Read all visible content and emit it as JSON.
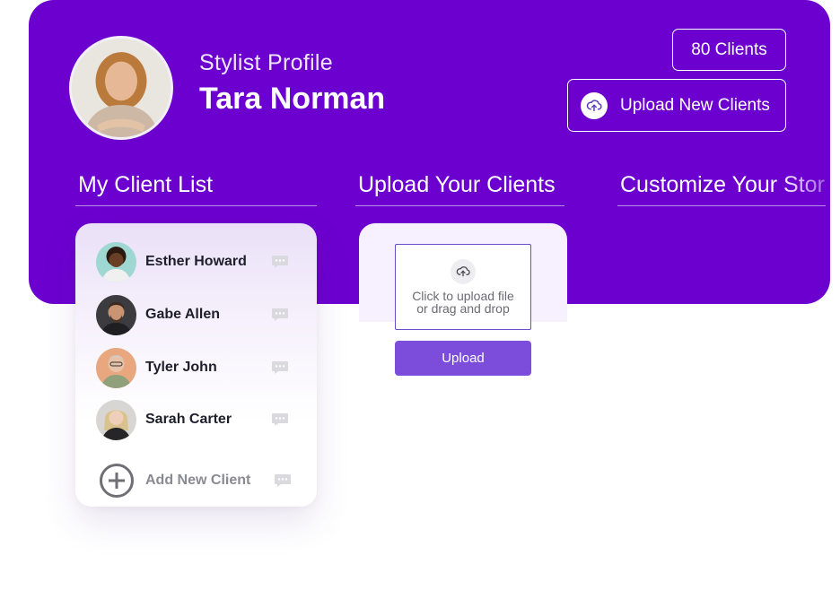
{
  "profile": {
    "subtitle": "Stylist Profile",
    "name": "Tara Norman"
  },
  "header": {
    "clients_count": "80 Clients",
    "upload_label": "Upload New Clients"
  },
  "tabs": [
    {
      "label": "My Client List"
    },
    {
      "label": "Upload Your Clients"
    },
    {
      "label_strong": "Customize ",
      "label_fade": "Your Store"
    }
  ],
  "client_list": {
    "items": [
      {
        "name": "Esther Howard"
      },
      {
        "name": "Gabe Allen"
      },
      {
        "name": "Tyler John"
      },
      {
        "name": "Sarah Carter"
      }
    ],
    "add_label": "Add New Client"
  },
  "upload": {
    "drop_line1": "Click to upload file",
    "drop_line2": "or drag and drop",
    "button_label": "Upload"
  },
  "colors": {
    "brand_purple": "#6c00cf",
    "upload_button": "#7c4ddb",
    "card_tint": "#f7f0fe"
  },
  "icons": [
    "upload-cloud-icon",
    "chat-bubble-icon",
    "plus-circle-icon"
  ]
}
